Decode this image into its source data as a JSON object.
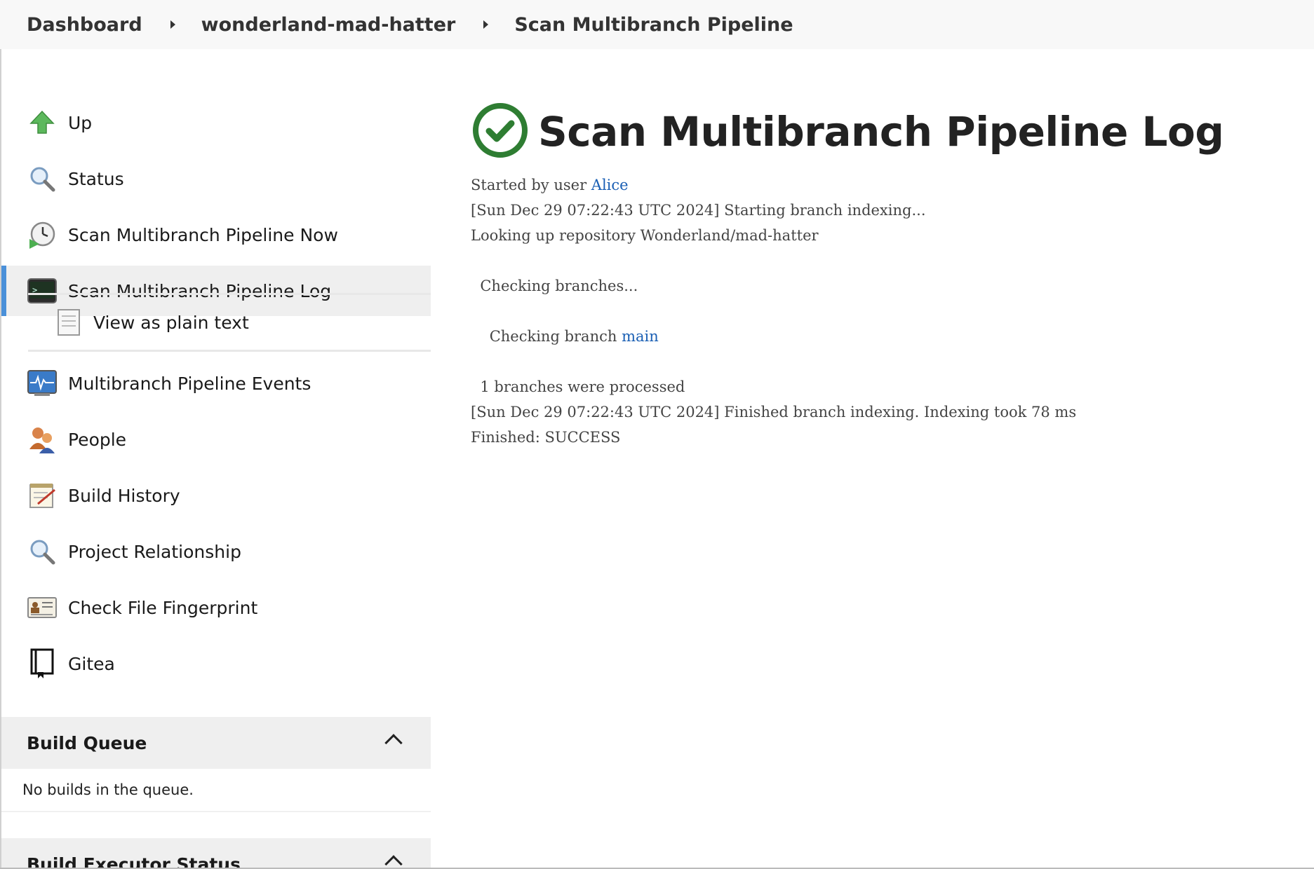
{
  "breadcrumb": {
    "items": [
      "Dashboard",
      "wonderland-mad-hatter",
      "Scan Multibranch Pipeline"
    ]
  },
  "sidebar": {
    "items": [
      {
        "label": "Up",
        "icon": "up-arrow-icon"
      },
      {
        "label": "Status",
        "icon": "magnifier-icon"
      },
      {
        "label": "Scan Multibranch Pipeline Now",
        "icon": "clock-icon"
      },
      {
        "label": "Scan Multibranch Pipeline Log",
        "icon": "terminal-icon"
      },
      {
        "label": "View as plain text",
        "icon": "document-icon"
      },
      {
        "label": "Multibranch Pipeline Events",
        "icon": "monitor-icon"
      },
      {
        "label": "People",
        "icon": "people-icon"
      },
      {
        "label": "Build History",
        "icon": "notepad-icon"
      },
      {
        "label": "Project Relationship",
        "icon": "magnifier-icon"
      },
      {
        "label": "Check File Fingerprint",
        "icon": "id-card-icon"
      },
      {
        "label": "Gitea",
        "icon": "book-icon"
      }
    ],
    "build_queue": {
      "title": "Build Queue",
      "empty_text": "No builds in the queue."
    },
    "build_executor": {
      "title": "Build Executor Status"
    }
  },
  "main": {
    "title": "Scan Multibranch Pipeline Log",
    "console": {
      "started_prefix": "Started by user ",
      "user": "Alice",
      "line_start": "[Sun Dec 29 07:22:43 UTC 2024] Starting branch indexing...",
      "line_lookup": "Looking up repository Wonderland/mad-hatter",
      "line_checking": "  Checking branches...",
      "line_branch_prefix": "    Checking branch ",
      "branch": "main",
      "line_processed": "  1 branches were processed",
      "line_finished_index": "[Sun Dec 29 07:22:43 UTC 2024] Finished branch indexing. Indexing took 78 ms",
      "line_result": "Finished: SUCCESS"
    }
  },
  "colors": {
    "success": "#2e7d32",
    "link": "#1a5fb4",
    "active_bar": "#4a90d9"
  }
}
